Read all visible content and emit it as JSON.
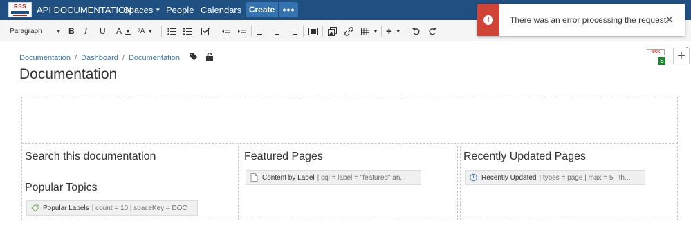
{
  "nav": {
    "site_title": "API DOCUMENTATION",
    "items": [
      {
        "label": "Spaces",
        "has_caret": true
      },
      {
        "label": "People",
        "has_caret": false
      },
      {
        "label": "Calendars",
        "has_caret": false
      }
    ],
    "create_label": "Create",
    "more_label": "•••",
    "logo_text": "RSS",
    "nav_color": "#205081"
  },
  "toolbar": {
    "paragraph_label": "Paragraph",
    "bold": "B",
    "italic": "I",
    "underline": "U",
    "text_color": "A",
    "text_size": "ᵃA",
    "help": "?"
  },
  "breadcrumb": [
    "Documentation",
    "Dashboard",
    "Documentation"
  ],
  "page": {
    "title": "Documentation",
    "badge_letter": "S"
  },
  "columns": {
    "col1_heading": "Search this documentation",
    "col1_subheading": "Popular Topics",
    "col1_macro": {
      "name": "Popular Labels",
      "params": "| count = 10 | spaceKey = DOC"
    },
    "col2_heading": "Featured Pages",
    "col2_macro": {
      "name": "Content by Label",
      "params": "| cql = label = \"featured\" an..."
    },
    "col3_heading": "Recently Updated Pages",
    "col3_macro": {
      "name": "Recently Updated",
      "params": "| types = page | max = 5 | th..."
    }
  },
  "toast": {
    "message": "There was an error processing the request.",
    "icon": "error-icon",
    "color": "#d04437"
  }
}
